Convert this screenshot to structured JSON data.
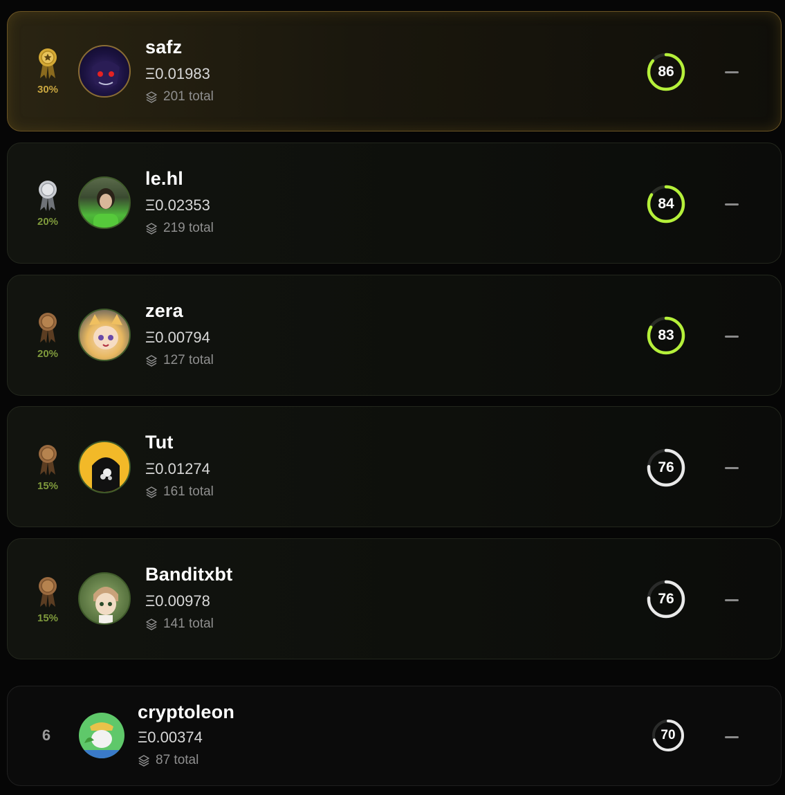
{
  "leaderboard": [
    {
      "rank_badge": "gold-medal",
      "payout_pct": "30%",
      "name": "safz",
      "eth": "Ξ0.01983",
      "total": "201 total",
      "score": "86",
      "score_fraction": 0.86,
      "trend": "—",
      "avatar_icon": "demon-avatar"
    },
    {
      "rank_badge": "silver-medal",
      "payout_pct": "20%",
      "name": "le.hl",
      "eth": "Ξ0.02353",
      "total": "219 total",
      "score": "84",
      "score_fraction": 0.84,
      "trend": "—",
      "avatar_icon": "person-photo-avatar"
    },
    {
      "rank_badge": "bronze-medal",
      "payout_pct": "20%",
      "name": "zera",
      "eth": "Ξ0.00794",
      "total": "127 total",
      "score": "83",
      "score_fraction": 0.83,
      "trend": "—",
      "avatar_icon": "anime-catgirl-avatar"
    },
    {
      "rank_badge": "bronze-medal",
      "payout_pct": "15%",
      "name": "Tut",
      "eth": "Ξ0.01274",
      "total": "161 total",
      "score": "76",
      "score_fraction": 0.76,
      "trend": "—",
      "avatar_icon": "hooded-figure-avatar"
    },
    {
      "rank_badge": "bronze-medal",
      "payout_pct": "15%",
      "name": "Banditxbt",
      "eth": "Ξ0.00978",
      "total": "141 total",
      "score": "76",
      "score_fraction": 0.76,
      "trend": "—",
      "avatar_icon": "anime-boy-avatar"
    },
    {
      "rank_number": "6",
      "name": "cryptoleon",
      "eth": "Ξ0.00374",
      "total": "87 total",
      "score": "70",
      "score_fraction": 0.7,
      "trend": "—",
      "avatar_icon": "cartoon-character-avatar"
    }
  ],
  "colors": {
    "gold": "#d4a935",
    "silver": "#c9ccd1",
    "bronze": "#9a6a3f",
    "pct_gold": "#c9a640",
    "pct_green": "#7f9a3c",
    "score_high": "#b5f03a",
    "score_mid": "#e9e9e9",
    "track": "#2a2d26"
  }
}
